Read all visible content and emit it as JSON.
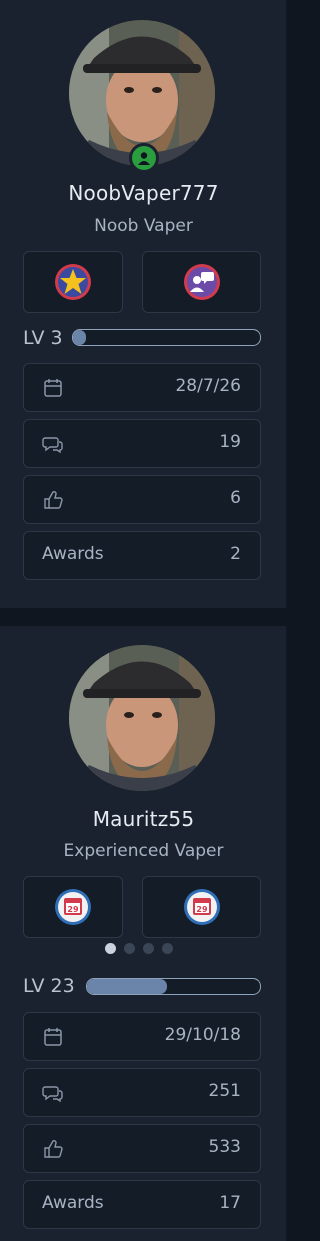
{
  "users": [
    {
      "username": "NoobVaper777",
      "title": "Noob Vaper",
      "online": true,
      "trophies": [
        "star-trophy-icon",
        "chat-trophy-icon"
      ],
      "level_label": "LV 3",
      "level_progress": 0.07,
      "stats": {
        "joined": "28/7/26",
        "messages": "19",
        "reactions": "6",
        "awards_label": "Awards",
        "awards": "2"
      }
    },
    {
      "username": "Mauritz55",
      "title": "Experienced Vaper",
      "online": false,
      "trophies": [
        "calendar-29-trophy-icon",
        "calendar-29-trophy-icon"
      ],
      "level_label": "LV 23",
      "level_progress": 0.46,
      "stats": {
        "joined": "29/10/18",
        "messages": "251",
        "reactions": "533",
        "awards_label": "Awards",
        "awards": "17"
      },
      "carousel": {
        "pages": 4,
        "active": 0
      }
    }
  ],
  "colors": {
    "background": "#0f1620",
    "card": "#19222e",
    "online": "#2a9d3f",
    "level_fill": "#6b85aa"
  },
  "calendar_day": "29"
}
